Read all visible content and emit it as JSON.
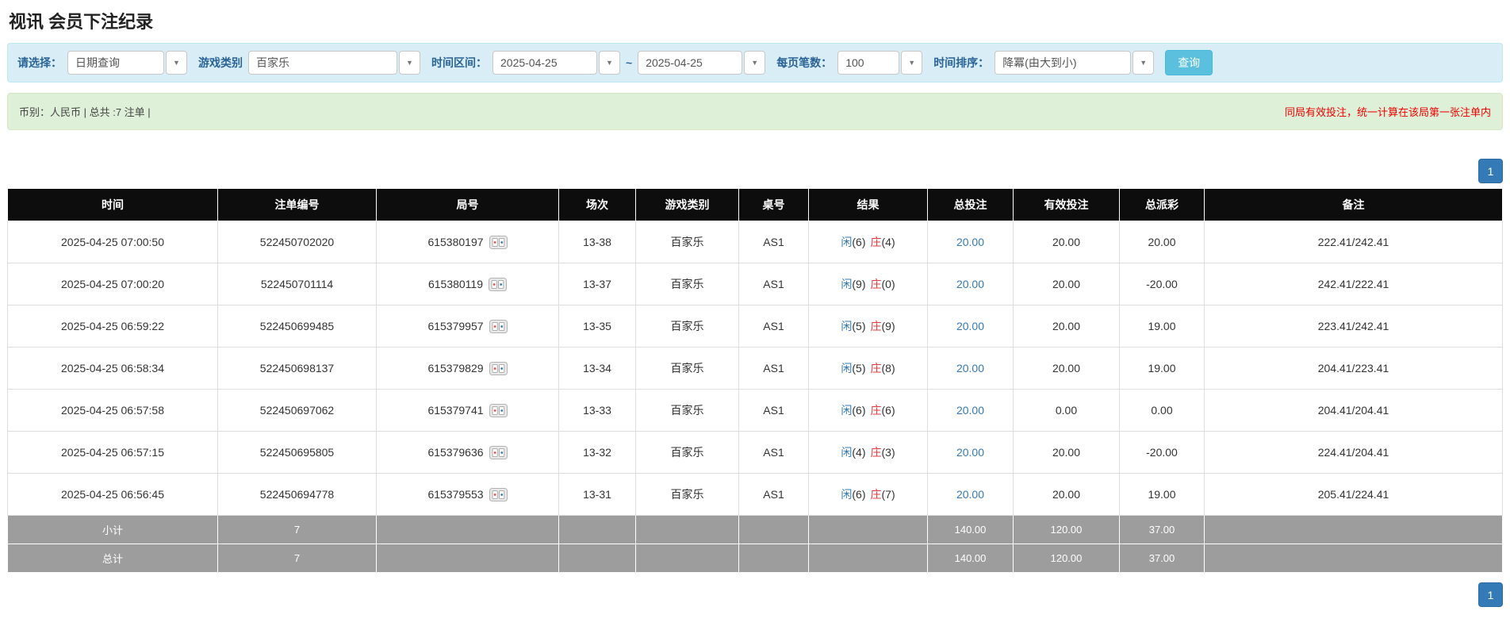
{
  "page_title": "视讯 会员下注纪录",
  "filter": {
    "select_label": "请选择：",
    "select_value": "日期查询",
    "game_type_label": "游戏类别",
    "game_type_value": "百家乐",
    "date_range_label": "时间区间：",
    "date_from": "2025-04-25",
    "date_separator": "~",
    "date_to": "2025-04-25",
    "page_size_label": "每页笔数：",
    "page_size_value": "100",
    "sort_label": "时间排序：",
    "sort_value": "降冪(由大到小)",
    "search_button": "查询"
  },
  "summary": {
    "left": "币别：人民币 | 总共 :7 注单 |",
    "right": "同局有效投注，统一计算在该局第一张注单内"
  },
  "pagination": {
    "page": "1"
  },
  "colors": {
    "accent_blue": "#337ab7",
    "player_blue": "#337ab7",
    "banker_red": "#e4393c",
    "negative_red": "#e4393c",
    "highlight_yellow": "#f7f298",
    "header_black": "#0d0d0d",
    "footer_gray": "#9d9d9d",
    "search_button_teal": "#5bc0de"
  },
  "table": {
    "headers": [
      "时间",
      "注单编号",
      "局号",
      "场次",
      "游戏类别",
      "桌号",
      "结果",
      "总投注",
      "有效投注",
      "总派彩",
      "备注"
    ],
    "rows": [
      {
        "time": "2025-04-25 07:00:50",
        "bet_id": "522450702020",
        "round_no": "615380197",
        "session": "13-38",
        "game": "百家乐",
        "table_no": "AS1",
        "result": {
          "player": "闲",
          "player_pts": "(6)",
          "banker": "庄",
          "banker_pts": "(4)"
        },
        "total_bet": "20.00",
        "valid_bet": "20.00",
        "payout": "20.00",
        "note": "222.41/242.41",
        "highlighted": false
      },
      {
        "time": "2025-04-25 07:00:20",
        "bet_id": "522450701114",
        "round_no": "615380119",
        "session": "13-37",
        "game": "百家乐",
        "table_no": "AS1",
        "result": {
          "player": "闲",
          "player_pts": "(9)",
          "banker": "庄",
          "banker_pts": "(0)"
        },
        "total_bet": "20.00",
        "valid_bet": "20.00",
        "payout": "-20.00",
        "note": "242.41/222.41",
        "highlighted": false
      },
      {
        "time": "2025-04-25 06:59:22",
        "bet_id": "522450699485",
        "round_no": "615379957",
        "session": "13-35",
        "game": "百家乐",
        "table_no": "AS1",
        "result": {
          "player": "闲",
          "player_pts": "(5)",
          "banker": "庄",
          "banker_pts": "(9)"
        },
        "total_bet": "20.00",
        "valid_bet": "20.00",
        "payout": "19.00",
        "note": "223.41/242.41",
        "highlighted": false
      },
      {
        "time": "2025-04-25 06:58:34",
        "bet_id": "522450698137",
        "round_no": "615379829",
        "session": "13-34",
        "game": "百家乐",
        "table_no": "AS1",
        "result": {
          "player": "闲",
          "player_pts": "(5)",
          "banker": "庄",
          "banker_pts": "(8)"
        },
        "total_bet": "20.00",
        "valid_bet": "20.00",
        "payout": "19.00",
        "note": "204.41/223.41",
        "highlighted": false
      },
      {
        "time": "2025-04-25 06:57:58",
        "bet_id": "522450697062",
        "round_no": "615379741",
        "session": "13-33",
        "game": "百家乐",
        "table_no": "AS1",
        "result": {
          "player": "闲",
          "player_pts": "(6)",
          "banker": "庄",
          "banker_pts": "(6)"
        },
        "total_bet": "20.00",
        "valid_bet": "0.00",
        "payout": "0.00",
        "note": "204.41/204.41",
        "highlighted": false
      },
      {
        "time": "2025-04-25 06:57:15",
        "bet_id": "522450695805",
        "round_no": "615379636",
        "session": "13-32",
        "game": "百家乐",
        "table_no": "AS1",
        "result": {
          "player": "闲",
          "player_pts": "(4)",
          "banker": "庄",
          "banker_pts": "(3)"
        },
        "total_bet": "20.00",
        "valid_bet": "20.00",
        "payout": "-20.00",
        "note": "224.41/204.41",
        "highlighted": false
      },
      {
        "time": "2025-04-25 06:56:45",
        "bet_id": "522450694778",
        "round_no": "615379553",
        "session": "13-31",
        "game": "百家乐",
        "table_no": "AS1",
        "result": {
          "player": "闲",
          "player_pts": "(6)",
          "banker": "庄",
          "banker_pts": "(7)"
        },
        "total_bet": "20.00",
        "valid_bet": "20.00",
        "payout": "19.00",
        "note": "205.41/224.41",
        "highlighted": true
      }
    ],
    "subtotal": {
      "label": "小计",
      "count": "7",
      "total_bet": "140.00",
      "valid_bet": "120.00",
      "payout": "37.00"
    },
    "total": {
      "label": "总计",
      "count": "7",
      "total_bet": "140.00",
      "valid_bet": "120.00",
      "payout": "37.00"
    }
  }
}
